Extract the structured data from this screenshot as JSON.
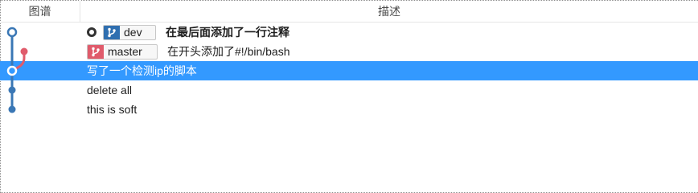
{
  "header": {
    "graph_label": "图谱",
    "desc_label": "描述"
  },
  "commits": [
    {
      "branch": "dev",
      "message": "在最后面添加了一行注释",
      "bold": true,
      "head": true
    },
    {
      "branch": "master",
      "message": "在开头添加了#!/bin/bash"
    },
    {
      "message": "写了一个检测ip的脚本",
      "selected": true
    },
    {
      "message": "delete all"
    },
    {
      "message": "this is soft"
    }
  ],
  "colors": {
    "lane_blue": "#3a77b5",
    "lane_red": "#e05b6b",
    "selection": "#3399ff"
  },
  "icons": {
    "branch_badge": "git-branch-icon",
    "head_marker": "head-ring-icon"
  }
}
